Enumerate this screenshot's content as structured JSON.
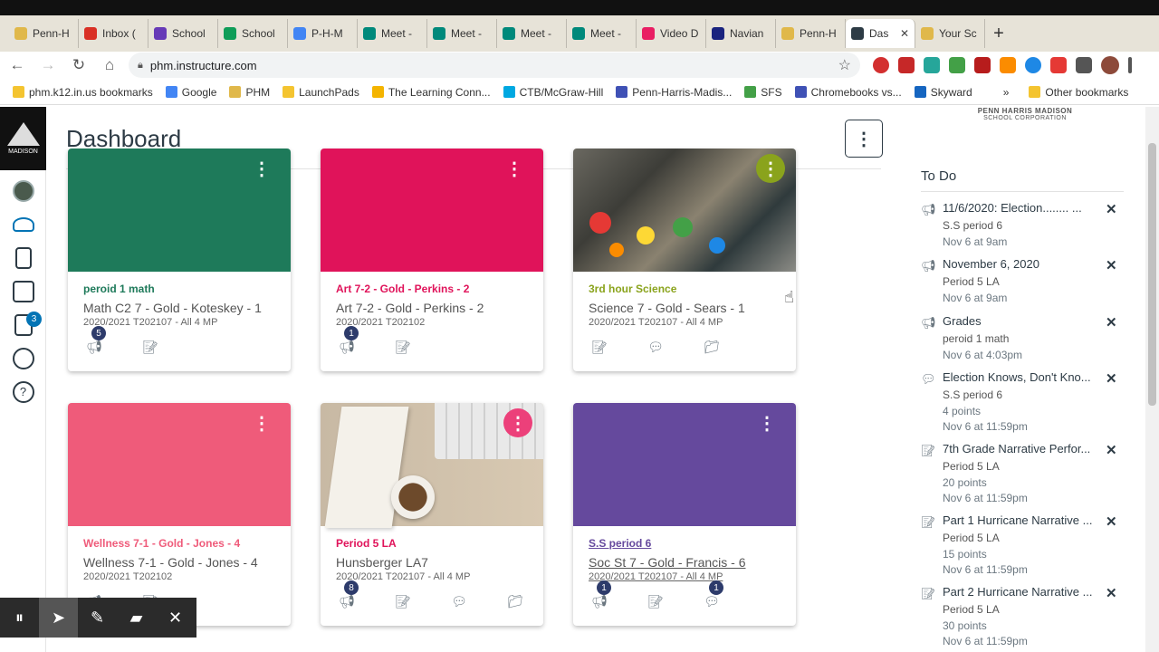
{
  "browser": {
    "tabs": [
      {
        "label": "Penn-H",
        "color": "#e0b84a",
        "active": false
      },
      {
        "label": "Inbox (",
        "color": "#d93025",
        "active": false
      },
      {
        "label": "School",
        "color": "#673ab7",
        "active": false
      },
      {
        "label": "School",
        "color": "#0f9d58",
        "active": false
      },
      {
        "label": "P-H-M",
        "color": "#4285f4",
        "active": false
      },
      {
        "label": "Meet -",
        "color": "#00897b",
        "active": false
      },
      {
        "label": "Meet -",
        "color": "#00897b",
        "active": false
      },
      {
        "label": "Meet -",
        "color": "#00897b",
        "active": false
      },
      {
        "label": "Meet -",
        "color": "#00897b",
        "active": false
      },
      {
        "label": "Video D",
        "color": "#e91e63",
        "active": false
      },
      {
        "label": "Navian",
        "color": "#1a237e",
        "active": false
      },
      {
        "label": "Penn-H",
        "color": "#e0b84a",
        "active": false
      },
      {
        "label": "Das",
        "color": "#2d3b45",
        "active": true
      },
      {
        "label": "Your Sc",
        "color": "#e0b84a",
        "active": false
      }
    ],
    "new_tab": "+",
    "url": "phm.instructure.com",
    "bookmarks": [
      {
        "label": "phm.k12.in.us bookmarks",
        "color": "#f4c430"
      },
      {
        "label": "Google",
        "color": "#4285f4"
      },
      {
        "label": "PHM",
        "color": "#e0b84a"
      },
      {
        "label": "LaunchPads",
        "color": "#f4c430"
      },
      {
        "label": "The Learning Conn...",
        "color": "#f4b400"
      },
      {
        "label": "CTB/McGraw-Hill",
        "color": "#00a8e1"
      },
      {
        "label": "Penn-Harris-Madis...",
        "color": "#3f51b5"
      },
      {
        "label": "SFS",
        "color": "#43a047"
      },
      {
        "label": "Chromebooks vs...",
        "color": "#3f51b5"
      },
      {
        "label": "Skyward",
        "color": "#1565c0"
      }
    ],
    "bookmarks_more": "»",
    "other_bookmarks": "Other bookmarks"
  },
  "nav": {
    "logo_text": "MADISON",
    "inbox_badge": "3"
  },
  "dashboard": {
    "title": "Dashboard",
    "kebab": "⋮",
    "cards": [
      {
        "code": "peroid 1 math",
        "name": "Math C2 7 - Gold - Koteskey - 1",
        "term": "2020/2021 T202107 - All 4 MP",
        "color": "#1e7a5a",
        "code_color": "#1e7a5a",
        "badge1": "5"
      },
      {
        "code": "Art 7-2 - Gold - Perkins - 2",
        "name": "Art 7-2 - Gold - Perkins - 2",
        "term": "2020/2021 T202102",
        "color": "#e0135a",
        "code_color": "#e0135a",
        "badge1": "1"
      },
      {
        "code": "3rd hour Science",
        "name": "Science 7 - Gold - Sears - 1",
        "term": "2020/2021 T202107 - All 4 MP",
        "color": "#8aa31c",
        "code_color": "#8aa31c"
      },
      {
        "code": "Wellness 7-1 - Gold - Jones - 4",
        "name": "Wellness 7-1 - Gold - Jones - 4",
        "term": "2020/2021 T202102",
        "color": "#ef5b7a",
        "code_color": "#ef5b7a"
      },
      {
        "code": "Period 5 LA",
        "name": "Hunsberger LA7",
        "term": "2020/2021 T202107 - All 4 MP",
        "color": "#ec407a",
        "code_color": "#e0135a",
        "badge1": "8"
      },
      {
        "code": "S.S period 6",
        "name": "Soc St 7 - Gold - Francis - 6",
        "term": "2020/2021 T202107 - All 4 MP",
        "color": "#65499d",
        "code_color": "#65499d",
        "badge1": "1",
        "badge3": "1"
      }
    ]
  },
  "school_logo": {
    "line1": "PENN HARRIS MADISON",
    "line2": "SCHOOL CORPORATION"
  },
  "todo": {
    "title": "To Do",
    "items": [
      {
        "icon": "announcement",
        "title": "11/6/2020: Election........ ...",
        "course": "S.S period 6",
        "points": "",
        "due": "Nov 6 at 9am"
      },
      {
        "icon": "announcement",
        "title": "November 6, 2020",
        "course": "Period 5 LA",
        "points": "",
        "due": "Nov 6 at 9am"
      },
      {
        "icon": "announcement",
        "title": "Grades",
        "course": "peroid 1 math",
        "points": "",
        "due": "Nov 6 at 4:03pm"
      },
      {
        "icon": "discussion",
        "title": "Election Knows, Don't Kno...",
        "course": "S.S period 6",
        "points": "4 points",
        "due": "Nov 6 at 11:59pm"
      },
      {
        "icon": "assignment",
        "title": "7th Grade Narrative Perfor...",
        "course": "Period 5 LA",
        "points": "20 points",
        "due": "Nov 6 at 11:59pm"
      },
      {
        "icon": "assignment",
        "title": "Part 1 Hurricane Narrative ...",
        "course": "Period 5 LA",
        "points": "15 points",
        "due": "Nov 6 at 11:59pm"
      },
      {
        "icon": "assignment",
        "title": "Part 2 Hurricane Narrative ...",
        "course": "Period 5 LA",
        "points": "30 points",
        "due": "Nov 6 at 11:59pm"
      }
    ],
    "dismiss": "✕"
  },
  "recorder": {
    "pause": "⏸",
    "pointer": "➤",
    "pen": "✎",
    "highlighter": "▰",
    "close": "✕"
  }
}
